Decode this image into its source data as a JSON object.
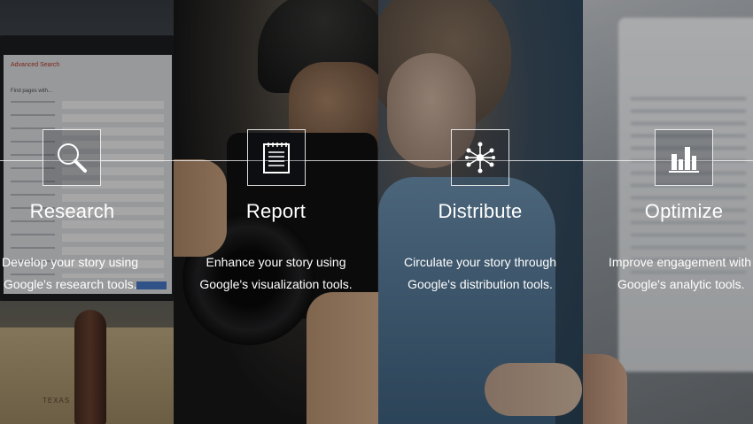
{
  "panels": [
    {
      "title": "Research",
      "desc_line1": "Develop your story using",
      "desc_line2": "Google's research tools.",
      "icon": "magnifier-icon"
    },
    {
      "title": "Report",
      "desc_line1": "Enhance your story using",
      "desc_line2": "Google's visualization tools.",
      "icon": "notepad-icon"
    },
    {
      "title": "Distribute",
      "desc_line1": "Circulate your story through",
      "desc_line2": "Google's distribution tools.",
      "icon": "network-icon"
    },
    {
      "title": "Optimize",
      "desc_line1": "Improve engagement with",
      "desc_line2": "Google's analytic tools.",
      "icon": "bar-chart-icon"
    }
  ],
  "background_scene": {
    "search_form_title": "Advanced Search",
    "search_form_subtitle": "Find pages with...",
    "map_label": "TEXAS"
  }
}
